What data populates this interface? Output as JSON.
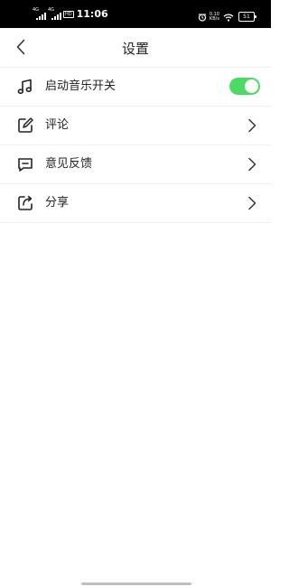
{
  "status_bar": {
    "time": "11:06",
    "network_1": "4G",
    "network_2": "4G",
    "hd_badge": "HD",
    "speed_value": "0.10",
    "speed_unit": "KB/s",
    "battery": "51",
    "icons": [
      "signal-icon",
      "signal-icon",
      "alarm-icon",
      "wifi-icon",
      "battery-icon"
    ]
  },
  "header": {
    "title": "设置",
    "back_icon": "chevron-left-icon"
  },
  "settings": {
    "items": [
      {
        "label": "启动音乐开关",
        "icon": "music-note-icon",
        "control": "toggle",
        "enabled": true
      },
      {
        "label": "评论",
        "icon": "edit-icon",
        "control": "chevron"
      },
      {
        "label": "意见反馈",
        "icon": "feedback-icon",
        "control": "chevron"
      },
      {
        "label": "分享",
        "icon": "share-icon",
        "control": "chevron"
      }
    ]
  },
  "colors": {
    "toggle_on": "#4cd964",
    "status_bar_bg": "#000000",
    "divider": "#efefef",
    "background": "#ffffff"
  }
}
